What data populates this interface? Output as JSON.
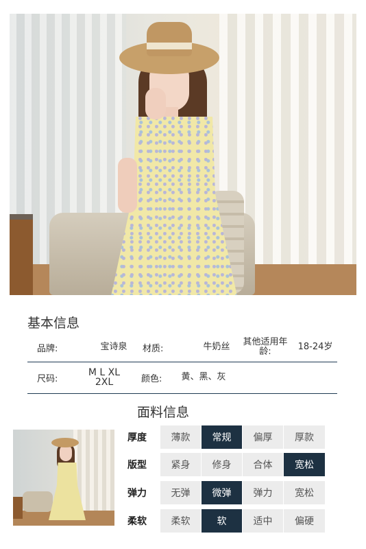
{
  "basic_info": {
    "title": "基本信息",
    "row1": {
      "brand_label": "品牌:",
      "brand_value": "宝诗泉",
      "material_label": "材质:",
      "material_value": "牛奶丝",
      "age_label": "其他适用年龄:",
      "age_value": "18-24岁"
    },
    "row2": {
      "size_label": "尺码:",
      "size_value": "M L XL 2XL",
      "color_label": "颜色:",
      "color_value": "黄、黑、灰"
    }
  },
  "fabric_info": {
    "title": "面料信息",
    "rows": [
      {
        "label": "厚度",
        "options": [
          "薄款",
          "常规",
          "偏厚",
          "厚款"
        ],
        "selected": 1
      },
      {
        "label": "版型",
        "options": [
          "紧身",
          "修身",
          "合体",
          "宽松"
        ],
        "selected": 3
      },
      {
        "label": "弹力",
        "options": [
          "无弹",
          "微弹",
          "弹力",
          "宽松"
        ],
        "selected": 1
      },
      {
        "label": "柔软",
        "options": [
          "柔软",
          "软",
          "适中",
          "偏硬"
        ],
        "selected": 1
      }
    ]
  },
  "colors": {
    "accent": "#1d3142",
    "option_bg": "#ececec",
    "divider": "#1e3a52"
  }
}
